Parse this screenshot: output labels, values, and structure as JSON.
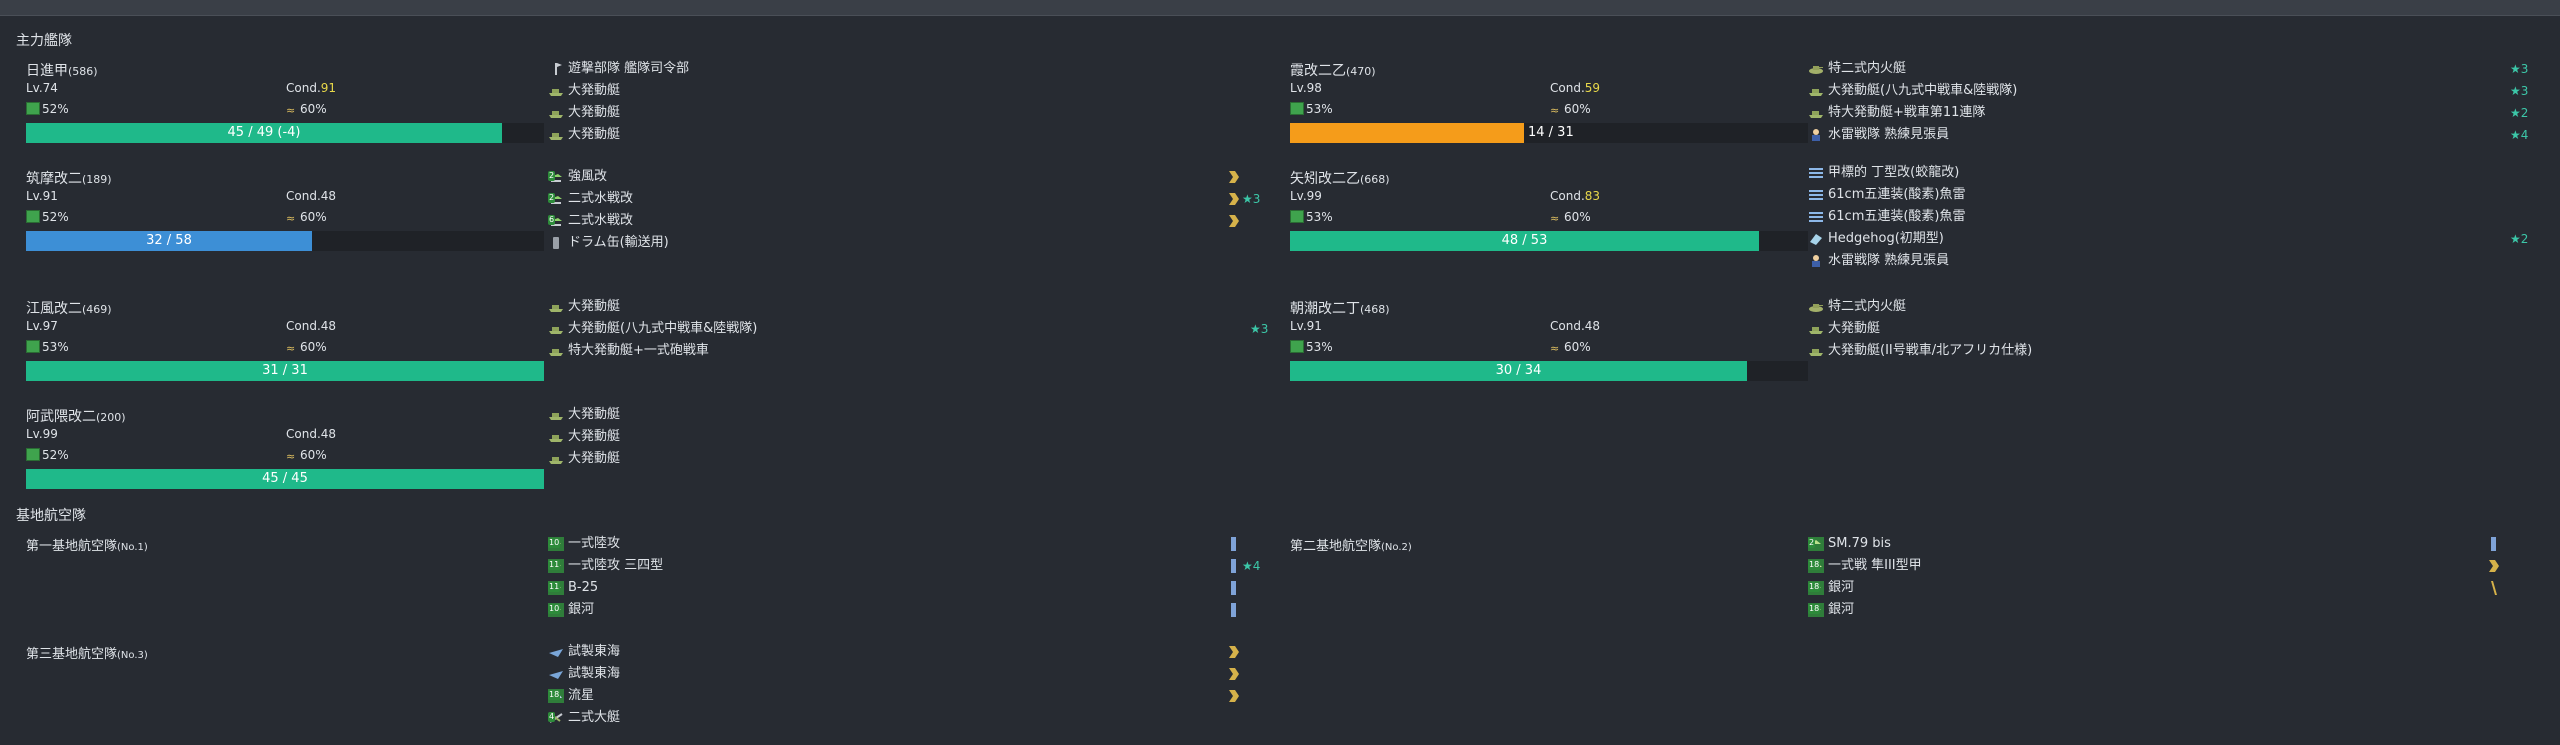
{
  "sections": {
    "fleet": "主力艦隊",
    "lbas": "基地航空隊"
  },
  "colors": {
    "hp_green": "#1fb98a",
    "hp_orange": "#f59c1a",
    "hp_blue": "#3d8fd6",
    "cond_yellow": "#e8d84a",
    "star": "#3cc7a8",
    "gold": "#d6b24a"
  },
  "ships": [
    {
      "name": "日進甲",
      "id": "(586)",
      "lv": "Lv.74",
      "cond_label": "Cond.",
      "cond": "91",
      "fuel": "52%",
      "ammo": "60%",
      "hp": "45 / 49 (-4)",
      "hp_fraction": 0.918,
      "hp_color": "green",
      "equips": [
        {
          "name": "遊撃部隊 艦隊司令部",
          "icon": "command-icon"
        },
        {
          "name": "大発動艇",
          "icon": "landing-craft-icon"
        },
        {
          "name": "大発動艇",
          "icon": "landing-craft-icon"
        },
        {
          "name": "大発動艇",
          "icon": "landing-craft-icon"
        }
      ]
    },
    {
      "name": "霞改二乙",
      "id": "(470)",
      "lv": "Lv.98",
      "cond_label": "Cond.",
      "cond": "59",
      "fuel": "53%",
      "ammo": "60%",
      "hp": "14 / 31",
      "hp_fraction": 0.452,
      "hp_color": "orange",
      "equips": [
        {
          "name": "特二式内火艇",
          "icon": "amphibious-tank-icon",
          "star": "★3"
        },
        {
          "name": "大発動艇(八九式中戦車&陸戦隊)",
          "icon": "landing-craft-icon",
          "star": "★3"
        },
        {
          "name": "特大発動艇+戦車第11連隊",
          "icon": "landing-craft-icon",
          "star": "★2"
        },
        {
          "name": "水雷戦隊 熟練見張員",
          "icon": "lookout-icon",
          "star": "★4"
        }
      ]
    },
    {
      "name": "筑摩改二",
      "id": "(189)",
      "lv": "Lv.91",
      "cond_label": "Cond.",
      "cond": "48",
      "fuel": "52%",
      "ammo": "60%",
      "hp": "32 / 58",
      "hp_fraction": 0.552,
      "hp_color": "blue",
      "equips": [
        {
          "name": "強風改",
          "icon": "seaplane-fighter-icon",
          "lvl": "2",
          "prof": "chevron"
        },
        {
          "name": "二式水戦改",
          "icon": "seaplane-fighter-icon",
          "lvl": "2",
          "prof": "chevron",
          "star": "★3"
        },
        {
          "name": "二式水戦改",
          "icon": "seaplane-fighter-icon",
          "lvl": "6",
          "prof": "chevron"
        },
        {
          "name": "ドラム缶(輸送用)",
          "icon": "drum-canister-icon"
        }
      ]
    },
    {
      "name": "矢矧改二乙",
      "id": "(668)",
      "lv": "Lv.99",
      "cond_label": "Cond.",
      "cond": "83",
      "fuel": "53%",
      "ammo": "60%",
      "hp": "48 / 53",
      "hp_fraction": 0.906,
      "hp_color": "green",
      "equips": [
        {
          "name": "甲標的 丁型改(蛟龍改)",
          "icon": "torpedo-icon"
        },
        {
          "name": "61cm五連装(酸素)魚雷",
          "icon": "torpedo-icon"
        },
        {
          "name": "61cm五連装(酸素)魚雷",
          "icon": "torpedo-icon"
        },
        {
          "name": "Hedgehog(初期型)",
          "icon": "sonar-icon",
          "star": "★2"
        },
        {
          "name": "水雷戦隊 熟練見張員",
          "icon": "lookout-icon"
        }
      ]
    },
    {
      "name": "江風改二",
      "id": "(469)",
      "lv": "Lv.97",
      "cond_label": "Cond.",
      "cond": "48",
      "fuel": "53%",
      "ammo": "60%",
      "hp": "31 / 31",
      "hp_fraction": 1.0,
      "hp_color": "green",
      "equips": [
        {
          "name": "大発動艇",
          "icon": "landing-craft-icon"
        },
        {
          "name": "大発動艇(八九式中戦車&陸戦隊)",
          "icon": "landing-craft-icon",
          "star": "★3"
        },
        {
          "name": "特大発動艇+一式砲戦車",
          "icon": "landing-craft-icon"
        }
      ]
    },
    {
      "name": "朝潮改二丁",
      "id": "(468)",
      "lv": "Lv.91",
      "cond_label": "Cond.",
      "cond": "48",
      "fuel": "53%",
      "ammo": "60%",
      "hp": "30 / 34",
      "hp_fraction": 0.882,
      "hp_color": "green",
      "equips": [
        {
          "name": "特二式内火艇",
          "icon": "amphibious-tank-icon"
        },
        {
          "name": "大発動艇",
          "icon": "landing-craft-icon"
        },
        {
          "name": "大発動艇(II号戦車/北アフリカ仕様)",
          "icon": "landing-craft-icon"
        }
      ]
    },
    {
      "name": "阿武隈改二",
      "id": "(200)",
      "lv": "Lv.99",
      "cond_label": "Cond.",
      "cond": "48",
      "fuel": "52%",
      "ammo": "60%",
      "hp": "45 / 45",
      "hp_fraction": 1.0,
      "hp_color": "green",
      "equips": [
        {
          "name": "大発動艇",
          "icon": "landing-craft-icon"
        },
        {
          "name": "大発動艇",
          "icon": "landing-craft-icon"
        },
        {
          "name": "大発動艇",
          "icon": "landing-craft-icon"
        }
      ]
    }
  ],
  "lbas": [
    {
      "name": "第一基地航空隊",
      "no": "(No.1)",
      "equips": [
        {
          "name": "一式陸攻",
          "icon": "land-bomber-icon",
          "lvl": "10",
          "prof": "bar"
        },
        {
          "name": "一式陸攻 三四型",
          "icon": "land-bomber-icon",
          "lvl": "11",
          "prof": "bar",
          "star": "★4"
        },
        {
          "name": "B-25",
          "icon": "land-bomber-icon",
          "lvl": "11",
          "prof": "bar"
        },
        {
          "name": "銀河",
          "icon": "land-bomber-icon",
          "lvl": "10",
          "prof": "bar"
        }
      ]
    },
    {
      "name": "第二基地航空隊",
      "no": "(No.2)",
      "equips": [
        {
          "name": "SM.79 bis",
          "icon": "land-bomber-icon",
          "lvl": "2",
          "prof": "bar"
        },
        {
          "name": "一式戦 隼III型甲",
          "icon": "fighter-icon",
          "lvl": "18",
          "prof": "chevron"
        },
        {
          "name": "銀河",
          "icon": "land-bomber-icon",
          "lvl": "18",
          "prof": "slash"
        },
        {
          "name": "銀河",
          "icon": "land-bomber-icon",
          "lvl": "18"
        }
      ]
    },
    {
      "name": "第三基地航空隊",
      "no": "(No.3)",
      "equips": [
        {
          "name": "試製東海",
          "icon": "patrol-plane-icon",
          "prof": "chevron"
        },
        {
          "name": "試製東海",
          "icon": "patrol-plane-icon",
          "prof": "chevron"
        },
        {
          "name": "流星",
          "icon": "torpedo-bomber-icon",
          "lvl": "18",
          "prof": "chevron"
        },
        {
          "name": "二式大艇",
          "icon": "flying-boat-icon",
          "lvl": "4"
        }
      ]
    }
  ]
}
